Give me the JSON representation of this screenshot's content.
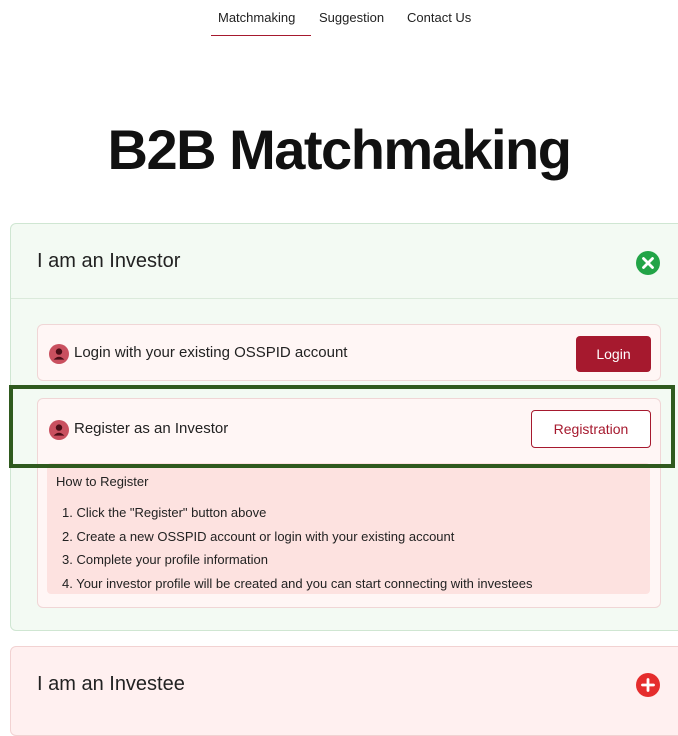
{
  "nav": {
    "items": [
      {
        "label": "Matchmaking",
        "active": true
      },
      {
        "label": "Suggestion",
        "active": false
      },
      {
        "label": "Contact Us",
        "active": false
      }
    ]
  },
  "page": {
    "title": "B2B Matchmaking"
  },
  "investor_panel": {
    "title": "I am an Investor",
    "toggle_icon": "close-circle-icon",
    "toggle_color": "#22a447",
    "login_card": {
      "text": "Login with your existing OSSPID account",
      "button_label": "Login",
      "icon": "person-icon"
    },
    "register_card": {
      "text": "Register as an Investor",
      "button_label": "Registration",
      "icon": "person-icon",
      "howto_title": "How to Register",
      "steps": [
        "1. Click the \"Register\" button above",
        "2. Create a new OSSPID account or login with your existing account",
        "3. Complete your profile information",
        "4. Your investor profile will be created and you can start connecting with investees"
      ]
    }
  },
  "investee_panel": {
    "title": "I am an Investee",
    "toggle_icon": "plus-circle-icon",
    "toggle_color": "#e52d2d"
  },
  "colors": {
    "brand": "#a6192e",
    "highlight": "#2f5a1e",
    "investor_bg": "#f3faf3",
    "investee_bg": "#fff0f0"
  }
}
